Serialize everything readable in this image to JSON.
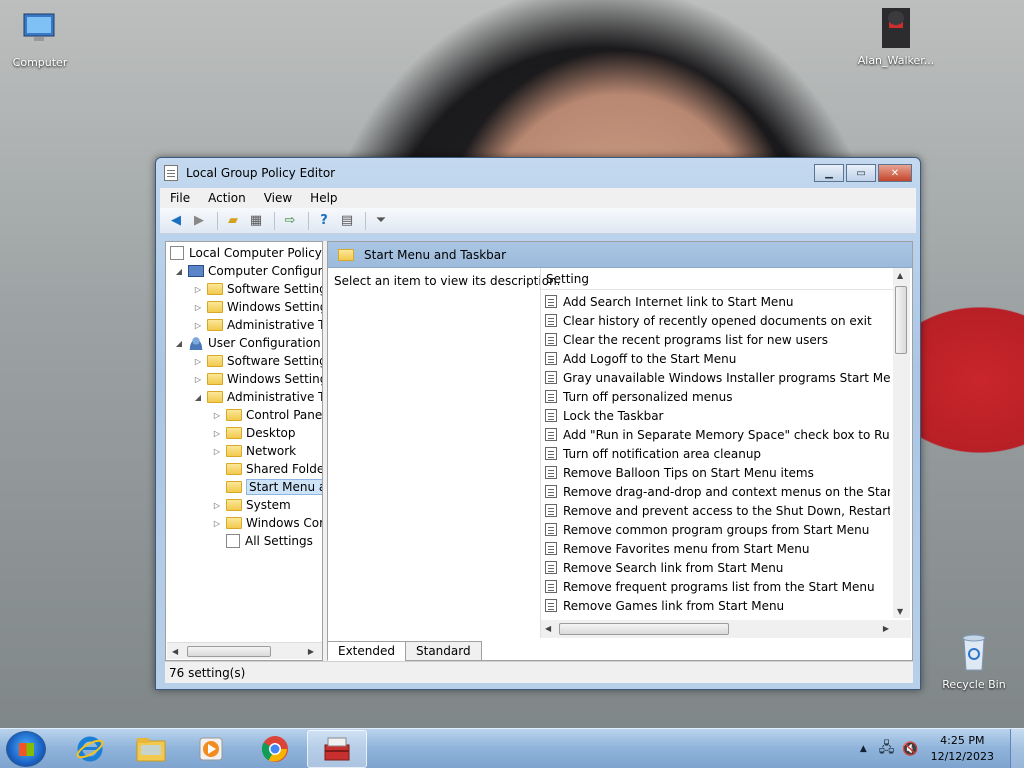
{
  "desktop": {
    "icons": [
      {
        "label": "Computer"
      },
      {
        "label": "Alan_Walker..."
      },
      {
        "label": "Recycle Bin"
      }
    ]
  },
  "window": {
    "title": "Local Group Policy Editor",
    "menu": [
      "File",
      "Action",
      "View",
      "Help"
    ],
    "tree": [
      {
        "label": "Local Computer Policy"
      },
      {
        "label": "Computer Configura"
      },
      {
        "label": "Software Settings"
      },
      {
        "label": "Windows Setting"
      },
      {
        "label": "Administrative Te"
      },
      {
        "label": "User Configuration"
      },
      {
        "label": "Software Settings"
      },
      {
        "label": "Windows Setting"
      },
      {
        "label": "Administrative Te"
      },
      {
        "label": "Control Panel"
      },
      {
        "label": "Desktop"
      },
      {
        "label": "Network"
      },
      {
        "label": "Shared Folder"
      },
      {
        "label": "Start Menu ar"
      },
      {
        "label": "System"
      },
      {
        "label": "Windows Cor"
      },
      {
        "label": "All Settings"
      }
    ],
    "pane_header": "Start Menu and Taskbar",
    "description": "Select an item to view its description.",
    "column_header": "Setting",
    "settings": [
      "Add Search Internet link to Start Menu",
      "Clear history of recently opened documents on exit",
      "Clear the recent programs list for new users",
      "Add Logoff to the Start Menu",
      "Gray unavailable Windows Installer programs Start Menu sh...",
      "Turn off personalized menus",
      "Lock the Taskbar",
      "Add \"Run in Separate Memory Space\" check box to Run dial...",
      "Turn off notification area cleanup",
      "Remove Balloon Tips on Start Menu items",
      "Remove drag-and-drop and context menus on the Start Me...",
      "Remove and prevent access to the Shut Down, Restart, Sleep...",
      "Remove common program groups from Start Menu",
      "Remove Favorites menu from Start Menu",
      "Remove Search link from Start Menu",
      "Remove frequent programs list from the Start Menu",
      "Remove Games link from Start Menu"
    ],
    "tabs": [
      "Extended",
      "Standard"
    ],
    "status": "76 setting(s)"
  },
  "taskbar": {
    "time": "4:25 PM",
    "date": "12/12/2023"
  }
}
